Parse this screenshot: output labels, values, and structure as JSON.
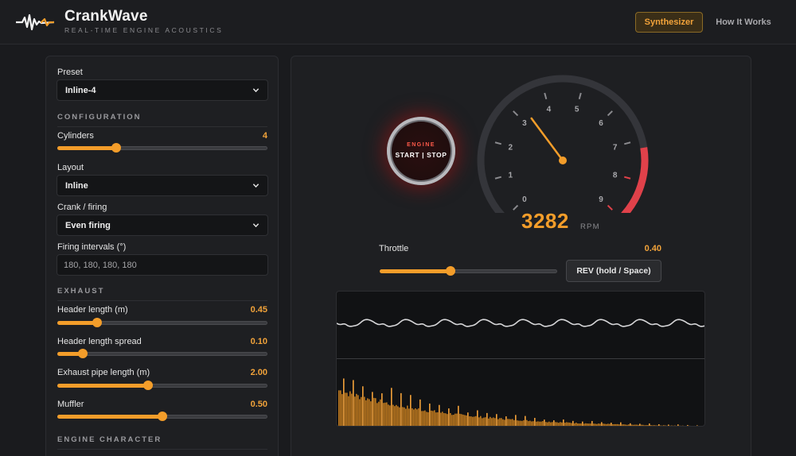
{
  "header": {
    "brand_name": "CrankWave",
    "brand_tagline": "REAL-TIME ENGINE ACOUSTICS",
    "nav": [
      {
        "label": "Synthesizer",
        "active": true
      },
      {
        "label": "How It Works",
        "active": false
      }
    ]
  },
  "controls": {
    "preset": {
      "label": "Preset",
      "value": "Inline-4"
    },
    "configuration_title": "CONFIGURATION",
    "cylinders": {
      "label": "Cylinders",
      "value": "4",
      "fraction": 0.28
    },
    "layout": {
      "label": "Layout",
      "value": "Inline"
    },
    "crank": {
      "label": "Crank / firing",
      "value": "Even firing"
    },
    "firing_intervals": {
      "label": "Firing intervals (°)",
      "placeholder": "180, 180, 180, 180"
    },
    "exhaust_title": "EXHAUST",
    "header_length": {
      "label": "Header length (m)",
      "value": "0.45",
      "fraction": 0.19
    },
    "header_spread": {
      "label": "Header length spread",
      "value": "0.10",
      "fraction": 0.12
    },
    "exhaust_pipe": {
      "label": "Exhaust pipe length (m)",
      "value": "2.00",
      "fraction": 0.43
    },
    "muffler": {
      "label": "Muffler",
      "value": "0.50",
      "fraction": 0.5
    },
    "engine_character_title": "ENGINE CHARACTER"
  },
  "engine": {
    "button_top": "ENGINE",
    "button_bottom": "START | STOP",
    "rpm": "3282",
    "rpm_unit": "RPM",
    "tach_labels": [
      "0",
      "1",
      "2",
      "3",
      "4",
      "5",
      "6",
      "7",
      "8",
      "9"
    ],
    "tach_max": 9,
    "redline_start": 7.2,
    "needle_value": 3.282,
    "throttle": {
      "label": "Throttle",
      "value": "0.40",
      "fraction": 0.4
    },
    "rev_button": "REV (hold / Space)"
  },
  "colors": {
    "accent": "#f39d2a",
    "redline": "#e0414a",
    "background": "#1a1b1e"
  },
  "icons": {
    "logo": "waveform-icon",
    "select_caret": "chevron-down-icon"
  }
}
